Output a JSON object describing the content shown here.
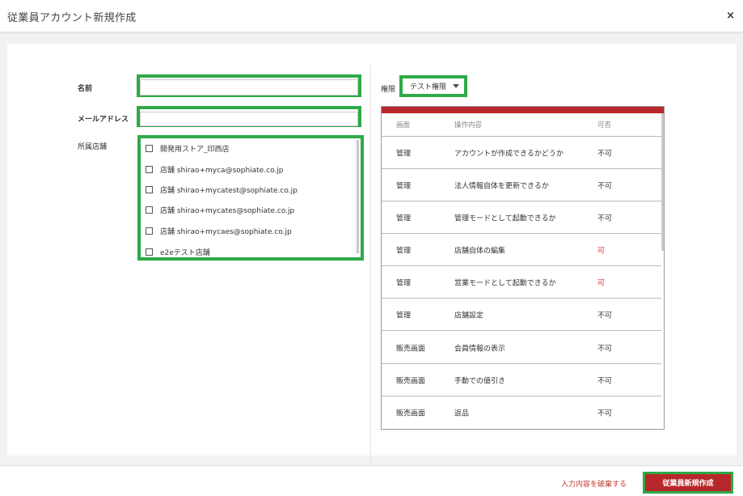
{
  "window": {
    "title": "従業員アカウント新規作成",
    "close_glyph": "×"
  },
  "form": {
    "name_label": "名前",
    "name_value": "",
    "email_label": "メールアドレス",
    "email_value": "",
    "stores_label": "所属店舗",
    "stores": [
      {
        "label": "開発用ストア_印西店",
        "checked": false
      },
      {
        "label": "店舗 shirao+myca@sophiate.co.jp",
        "checked": false
      },
      {
        "label": "店舗 shirao+mycatest@sophiate.co.jp",
        "checked": false
      },
      {
        "label": "店舗 shirao+mycates@sophiate.co.jp",
        "checked": false
      },
      {
        "label": "店舗 shirao+mycaes@sophiate.co.jp",
        "checked": false
      },
      {
        "label": "e2eテスト店舗",
        "checked": false
      }
    ]
  },
  "permission": {
    "label": "権限",
    "selected": "テスト権限",
    "table": {
      "headers": [
        "画面",
        "操作内容",
        "可否"
      ],
      "rows": [
        {
          "screen": "管理",
          "operation": "アカウントが作成できるかどうか",
          "allowed": "不可"
        },
        {
          "screen": "管理",
          "operation": "法人情報自体を更新できるか",
          "allowed": "不可"
        },
        {
          "screen": "管理",
          "operation": "管理モードとして起動できるか",
          "allowed": "不可"
        },
        {
          "screen": "管理",
          "operation": "店舗自体の編集",
          "allowed": "可"
        },
        {
          "screen": "管理",
          "operation": "営業モードとして起動できるか",
          "allowed": "可"
        },
        {
          "screen": "管理",
          "operation": "店舗設定",
          "allowed": "不可"
        },
        {
          "screen": "販売画面",
          "operation": "会員情報の表示",
          "allowed": "不可"
        },
        {
          "screen": "販売画面",
          "operation": "手動での値引き",
          "allowed": "不可"
        },
        {
          "screen": "販売画面",
          "operation": "返品",
          "allowed": "不可"
        }
      ]
    }
  },
  "footer": {
    "discard_label": "入力内容を破棄する",
    "submit_label": "従業員新規作成"
  },
  "colors": {
    "accent_red": "#b8272b",
    "highlight_green": "#2eaa47",
    "allowed_red": "#d0302f"
  }
}
